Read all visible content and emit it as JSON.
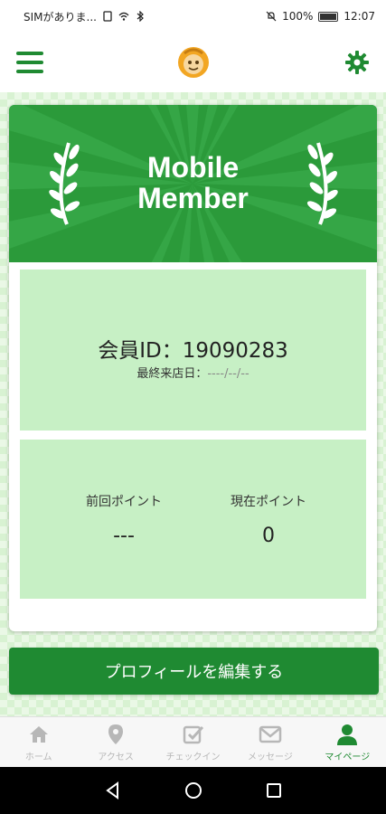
{
  "status_bar": {
    "carrier": "SIMがありま...",
    "battery": "100%",
    "time": "12:07"
  },
  "header": {
    "menu_icon": "hamburger-icon",
    "logo_icon": "mascot-logo",
    "settings_icon": "gear-icon"
  },
  "card": {
    "title_line1": "Mobile",
    "title_line2": "Member",
    "member_id_label": "会員ID：",
    "member_id": "19090283",
    "last_visit_label": "最終来店日：",
    "last_visit_value": "----/--/--",
    "prev_points_label": "前回ポイント",
    "prev_points_value": "---",
    "current_points_label": "現在ポイント",
    "current_points_value": "0"
  },
  "edit_profile_label": "プロフィールを編集する",
  "bottom_nav": {
    "items": [
      {
        "label": "ホーム",
        "icon": "home-icon"
      },
      {
        "label": "アクセス",
        "icon": "map-pin-icon"
      },
      {
        "label": "チェックイン",
        "icon": "checkin-icon"
      },
      {
        "label": "メッセージ",
        "icon": "mail-icon"
      },
      {
        "label": "マイページ",
        "icon": "user-icon"
      }
    ],
    "active_index": 4
  },
  "colors": {
    "primary": "#1f8a32",
    "header_green": "#2b9a3a",
    "panel": "#c7f0c5",
    "inactive": "#b7b7b7"
  }
}
